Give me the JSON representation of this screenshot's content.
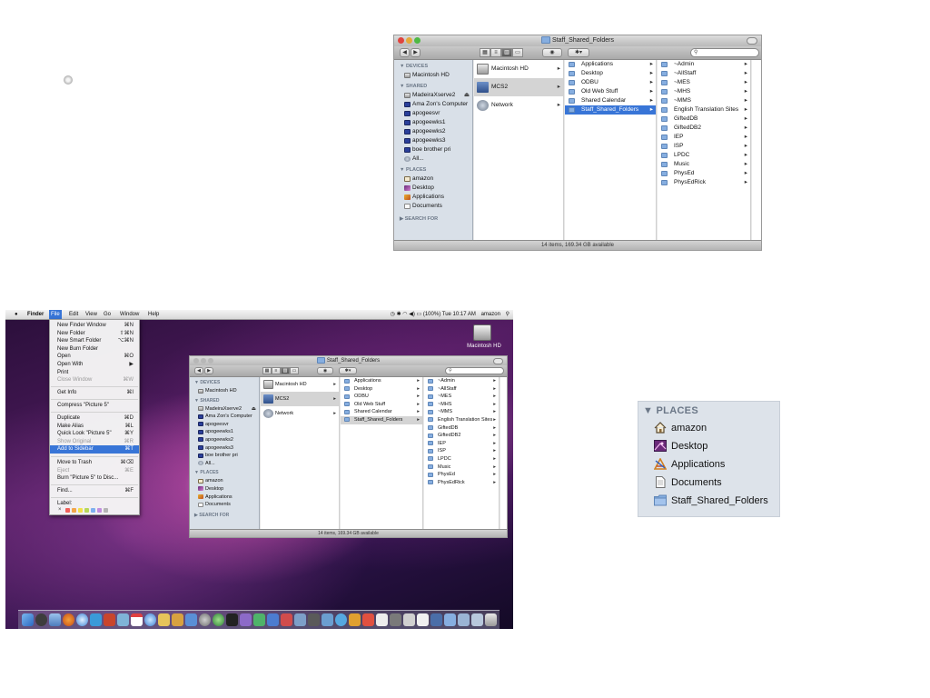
{
  "window": {
    "title": "Staff_Shared_Folders",
    "status": "14 items, 169.34 GB available",
    "search_placeholder": "",
    "sidebar": {
      "devices_header": "▼ DEVICES",
      "devices": [
        "Macintosh HD"
      ],
      "shared_header": "▼ SHARED",
      "shared": [
        "MadeiraXserve2",
        "Ama Zon's Computer",
        "apogeesvr",
        "apogeewks1",
        "apogeewks2",
        "apogeewks3",
        "boe brother pri",
        "All..."
      ],
      "places_header": "▼ PLACES",
      "places": [
        "amazon",
        "Desktop",
        "Applications",
        "Documents"
      ],
      "search_header": "▶ SEARCH FOR"
    },
    "col1": [
      "Macintosh HD",
      "MCS2",
      "Network"
    ],
    "col2": [
      "Applications",
      "Desktop",
      "ODBU",
      "Old Web Stuff",
      "Shared Calendar",
      "Staff_Shared_Folders"
    ],
    "col3": [
      "~Admin",
      "~AllStaff",
      "~MES",
      "~MHS",
      "~MMS",
      "English Translation Sites",
      "GiftedDB",
      "GiftedDB2",
      "IEP",
      "ISP",
      "LPDC",
      "Music",
      "PhysEd",
      "PhysEdRick"
    ]
  },
  "menubar": {
    "items": [
      "Finder",
      "File",
      "Edit",
      "View",
      "Go",
      "Window",
      "Help"
    ],
    "active": "File",
    "battery": "(100%)",
    "clock": "Tue 10:17 AM",
    "user": "amazon"
  },
  "file_menu": {
    "items": [
      {
        "label": "New Finder Window",
        "shortcut": "⌘N"
      },
      {
        "label": "New Folder",
        "shortcut": "⇧⌘N"
      },
      {
        "label": "New Smart Folder",
        "shortcut": "⌥⌘N"
      },
      {
        "label": "New Burn Folder",
        "shortcut": ""
      },
      {
        "label": "Open",
        "shortcut": "⌘O"
      },
      {
        "label": "Open With",
        "shortcut": "▶"
      },
      {
        "label": "Print",
        "shortcut": ""
      },
      {
        "label": "Close Window",
        "shortcut": "⌘W"
      },
      {
        "label": "Get Info",
        "shortcut": "⌘I"
      },
      {
        "label": "Compress \"Picture 5\"",
        "shortcut": ""
      },
      {
        "label": "Duplicate",
        "shortcut": "⌘D"
      },
      {
        "label": "Make Alias",
        "shortcut": "⌘L"
      },
      {
        "label": "Quick Look \"Picture 5\"",
        "shortcut": "⌘Y"
      },
      {
        "label": "Show Original",
        "shortcut": "⌘R"
      },
      {
        "label": "Add to Sidebar",
        "shortcut": "⌘T"
      },
      {
        "label": "Move to Trash",
        "shortcut": "⌘⌫"
      },
      {
        "label": "Eject",
        "shortcut": "⌘E"
      },
      {
        "label": "Burn \"Picture 5\" to Disc...",
        "shortcut": ""
      },
      {
        "label": "Find...",
        "shortcut": "⌘F"
      },
      {
        "label": "Label:",
        "shortcut": ""
      }
    ],
    "label_close": "×"
  },
  "desktop": {
    "hdd_label": "Macintosh HD"
  },
  "places_panel": {
    "header": "▼ PLACES",
    "items": [
      "amazon",
      "Desktop",
      "Applications",
      "Documents",
      "Staff_Shared_Folders"
    ]
  },
  "colors": {
    "selection": "#3875d7",
    "sidebar_bg": "#d9e0e8",
    "folder": "#86aee0"
  },
  "icons": {
    "home": "home-icon",
    "desktop": "desktop-icon",
    "applications": "applications-icon",
    "documents": "documents-icon",
    "folder": "folder-icon"
  }
}
